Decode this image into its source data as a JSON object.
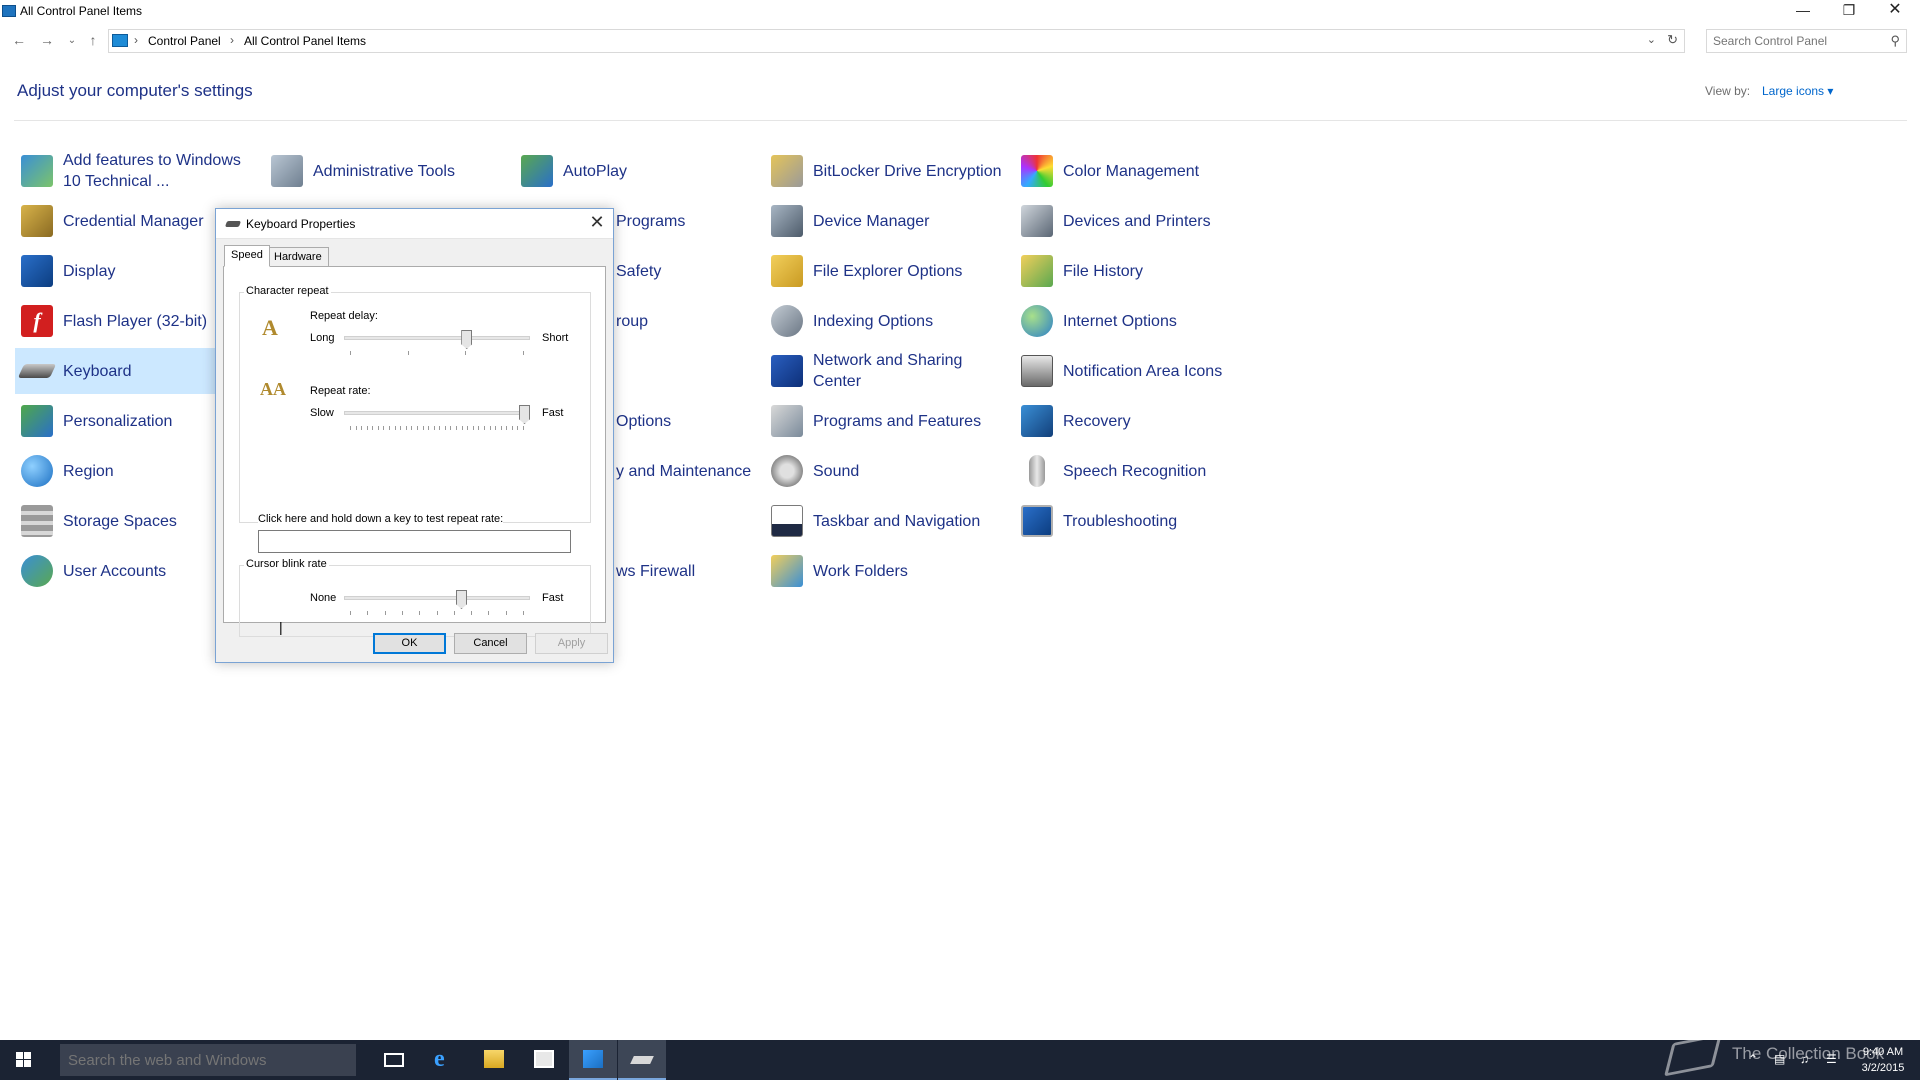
{
  "window": {
    "title": "All Control Panel Items"
  },
  "address": {
    "crumbs": [
      "Control Panel",
      "All Control Panel Items"
    ],
    "search_placeholder": "Search Control Panel"
  },
  "header": {
    "title": "Adjust your computer's settings",
    "view_by_label": "View by:",
    "view_by_value": "Large icons ▾"
  },
  "items": [
    {
      "label": "Add features to Windows 10 Technical ...",
      "icon": "add-features-icon"
    },
    {
      "label": "Administrative Tools",
      "icon": "admin-tools-icon"
    },
    {
      "label": "AutoPlay",
      "icon": "autoplay-icon"
    },
    {
      "label": "BitLocker Drive Encryption",
      "icon": "bitlocker-icon"
    },
    {
      "label": "Color Management",
      "icon": "color-management-icon"
    },
    {
      "label": "Credential Manager",
      "icon": "credential-manager-icon"
    },
    {
      "label": "Programs",
      "icon": "default-programs-icon"
    },
    {
      "label": "Device Manager",
      "icon": "device-manager-icon"
    },
    {
      "label": "Devices and Printers",
      "icon": "devices-printers-icon"
    },
    {
      "label": "Display",
      "icon": "display-icon"
    },
    {
      "label": "Safety",
      "icon": "family-safety-icon"
    },
    {
      "label": "File Explorer Options",
      "icon": "file-explorer-options-icon"
    },
    {
      "label": "File History",
      "icon": "file-history-icon"
    },
    {
      "label": "Flash Player (32-bit)",
      "icon": "flash-player-icon"
    },
    {
      "label": "roup",
      "icon": "homegroup-icon"
    },
    {
      "label": "Indexing Options",
      "icon": "indexing-options-icon"
    },
    {
      "label": "Internet Options",
      "icon": "internet-options-icon"
    },
    {
      "label": "Keyboard",
      "icon": "keyboard-icon"
    },
    {
      "label": "Network and Sharing Center",
      "icon": "network-sharing-icon"
    },
    {
      "label": "Notification Area Icons",
      "icon": "notification-area-icon"
    },
    {
      "label": "Personalization",
      "icon": "personalization-icon"
    },
    {
      "label": "Options",
      "icon": "power-options-icon"
    },
    {
      "label": "Programs and Features",
      "icon": "programs-features-icon"
    },
    {
      "label": "Recovery",
      "icon": "recovery-icon"
    },
    {
      "label": "Region",
      "icon": "region-icon"
    },
    {
      "label": "y and Maintenance",
      "icon": "security-maintenance-icon"
    },
    {
      "label": "Sound",
      "icon": "sound-icon"
    },
    {
      "label": "Speech Recognition",
      "icon": "speech-recognition-icon"
    },
    {
      "label": "Storage Spaces",
      "icon": "storage-spaces-icon"
    },
    {
      "label": "Taskbar and Navigation",
      "icon": "taskbar-navigation-icon"
    },
    {
      "label": "Troubleshooting",
      "icon": "troubleshooting-icon"
    },
    {
      "label": "User Accounts",
      "icon": "user-accounts-icon"
    },
    {
      "label": "ws Firewall",
      "icon": "windows-firewall-icon"
    },
    {
      "label": "Work Folders",
      "icon": "work-folders-icon"
    }
  ],
  "dialog": {
    "title": "Keyboard Properties",
    "tabs": [
      "Speed",
      "Hardware"
    ],
    "char_repeat_label": "Character repeat",
    "repeat_delay_label": "Repeat delay:",
    "repeat_delay_min": "Long",
    "repeat_delay_max": "Short",
    "repeat_delay_level": 0.67,
    "repeat_rate_label": "Repeat rate:",
    "repeat_rate_min": "Slow",
    "repeat_rate_max": "Fast",
    "repeat_rate_level": 1.0,
    "test_label": "Click here and hold down a key to test repeat rate:",
    "test_value": "",
    "blink_label": "Cursor blink rate",
    "blink_min": "None",
    "blink_max": "Fast",
    "blink_level": 0.64,
    "ok": "OK",
    "cancel": "Cancel",
    "apply": "Apply"
  },
  "taskbar": {
    "search_placeholder": "Search the web and Windows",
    "time": "9:40 AM",
    "date": "3/2/2015",
    "watermark": "The Collection Book"
  }
}
